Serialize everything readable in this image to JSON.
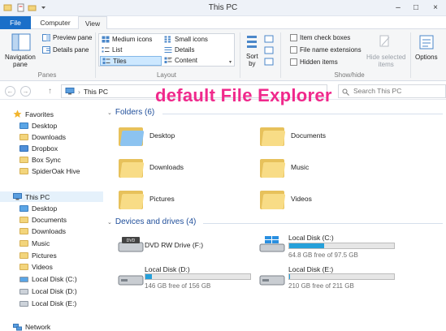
{
  "window": {
    "title": "This PC",
    "minimize": "–",
    "maximize": "□",
    "close": "×"
  },
  "ribbon_tabs": {
    "file": "File",
    "computer": "Computer",
    "view": "View"
  },
  "ribbon": {
    "panes": {
      "navigation_pane": "Navigation",
      "navigation_pane_2": "pane",
      "preview_pane": "Preview pane",
      "details_pane": "Details pane",
      "group_label": "Panes"
    },
    "layout": {
      "medium_icons": "Medium icons",
      "small_icons": "Small icons",
      "list": "List",
      "details": "Details",
      "tiles": "Tiles",
      "content": "Content",
      "group_label": "Layout"
    },
    "current_view": {
      "sort_by": "Sort",
      "sort_by_2": "by"
    },
    "show_hide": {
      "item_check_boxes": "Item check boxes",
      "file_name_extensions": "File name extensions",
      "hidden_items": "Hidden items",
      "hide_selected": "Hide selected",
      "hide_selected_2": "items",
      "group_label": "Show/hide"
    },
    "options": "Options"
  },
  "address_bar": {
    "back": "←",
    "forward": "→",
    "up": "↑",
    "crumb_sep": "›",
    "location": "This PC",
    "search_placeholder": "Search This PC"
  },
  "nav": {
    "favorites": "Favorites",
    "favorites_items": [
      "Desktop",
      "Downloads",
      "Dropbox",
      "Box Sync",
      "SpiderOak Hive"
    ],
    "this_pc": "This PC",
    "this_pc_items": [
      "Desktop",
      "Documents",
      "Downloads",
      "Music",
      "Pictures",
      "Videos",
      "Local Disk (C:)",
      "Local Disk (D:)",
      "Local Disk (E:)"
    ],
    "network": "Network"
  },
  "content": {
    "folders_header": "Folders (6)",
    "folders": [
      "Desktop",
      "Documents",
      "Downloads",
      "Music",
      "Pictures",
      "Videos"
    ],
    "devices_header": "Devices and drives (4)",
    "drives": [
      {
        "name": "DVD RW Drive (F:)",
        "free": "",
        "fill": null
      },
      {
        "name": "Local Disk (C:)",
        "free": "64.8 GB free of 97.5 GB",
        "fill": 0.335
      },
      {
        "name": "Local Disk (D:)",
        "free": "146 GB free of 156 GB",
        "fill": 0.064
      },
      {
        "name": "Local Disk (E:)",
        "free": "210 GB free of 211 GB",
        "fill": 0.005
      }
    ]
  },
  "overlay_caption": "default File Explorer",
  "colors": {
    "accent": "#1a6fc9",
    "caption": "#f0298c",
    "bar_fill": "#26a0da"
  }
}
